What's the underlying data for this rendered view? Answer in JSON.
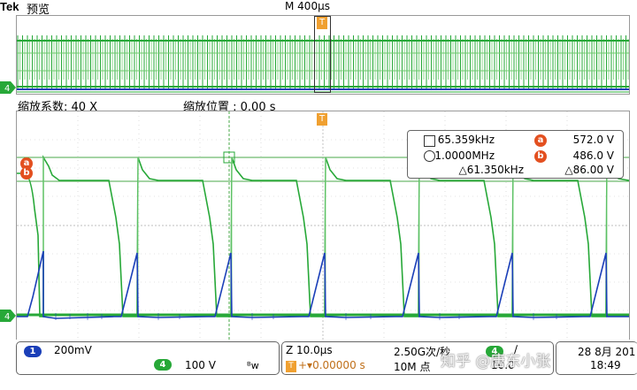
{
  "header": {
    "brand": "Tek",
    "mode": "预览",
    "timebase": "M 400μs",
    "trigger_marker": "T"
  },
  "zoom_info": {
    "factor": "缩放系数: 40 X",
    "position": "缩放位置 :  0.00 s"
  },
  "channel_markers": {
    "ch4": "4"
  },
  "cursor_readout": {
    "freq_a": "65.359kHz",
    "freq_b": "1.0000MHz",
    "freq_delta": "△61.350kHz",
    "volt_a": "572.0 V",
    "volt_b": "486.0 V",
    "volt_delta": "△86.00 V",
    "badge_a": "a",
    "badge_b": "b"
  },
  "status": {
    "ch1_num": "1",
    "ch1_scale": "200mV",
    "ch4_num": "4",
    "ch4_scale": "100 V",
    "ch4_bw": "ᴮw",
    "zoom_time": "Z 10.0μs",
    "trigger_icon": "T",
    "trigger_position": "+▾0.00000 s",
    "sample_rate": "2.50G次/秒",
    "record_length": "10M 点",
    "trigger_source": "4",
    "trigger_slope": "∕",
    "trigger_level": "10.0",
    "date": "28 8月 201",
    "time": "18:49"
  },
  "watermark": "知乎 @唐东小张",
  "colors": {
    "ch1": "#1a3fb8",
    "ch4": "#27a838",
    "trigger": "#f0a030",
    "cursor": "#e35020"
  },
  "icons": {
    "cursor_a_freq": "square-icon",
    "cursor_b_freq": "circle-icon"
  }
}
